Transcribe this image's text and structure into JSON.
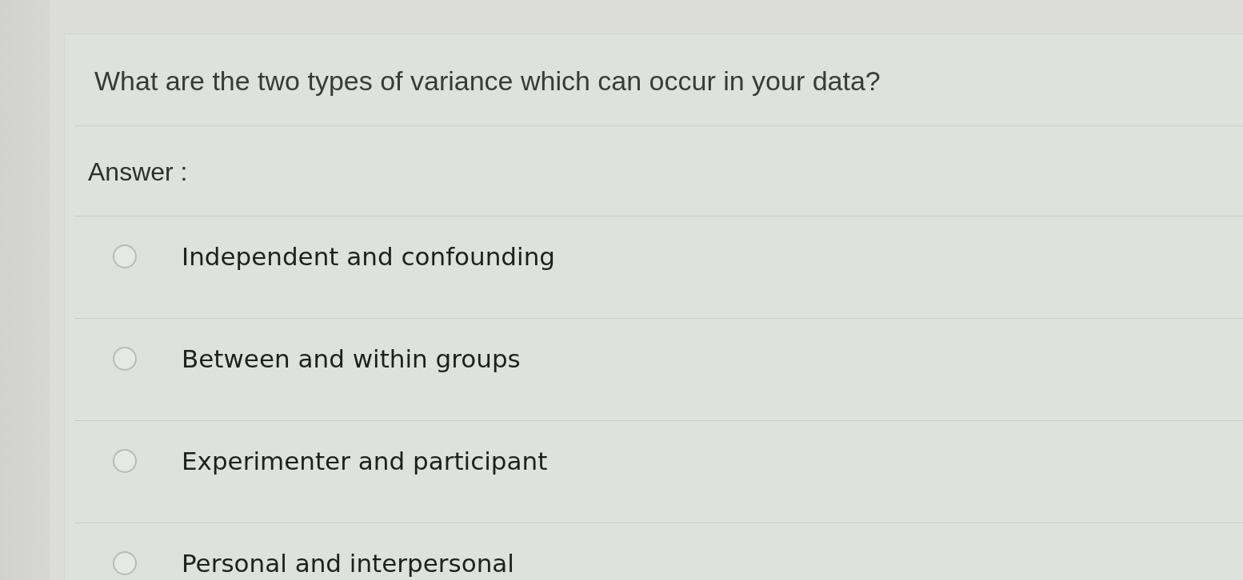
{
  "question": {
    "text": "What are the two types of variance which can occur in your data?"
  },
  "answer_label": "Answer :",
  "options": [
    {
      "label": "Independent and confounding",
      "selected": false
    },
    {
      "label": "Between and within groups",
      "selected": false
    },
    {
      "label": "Experimenter and participant",
      "selected": false
    },
    {
      "label": "Personal and interpersonal",
      "selected": false
    }
  ]
}
